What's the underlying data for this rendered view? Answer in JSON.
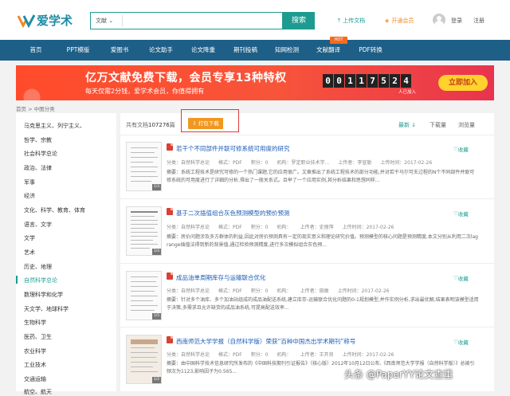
{
  "brand": {
    "name": "爱学术",
    "color": "#1f8ca6"
  },
  "search": {
    "type": "文献",
    "button": "搜索"
  },
  "header": {
    "upload": "上传文档",
    "vip": "开通会员",
    "login": "登录",
    "register": "注册"
  },
  "nav": {
    "items": [
      "首页",
      "PPT模版",
      "爱图书",
      "论文助手",
      "论文降重",
      "期刊投稿",
      "知网检测",
      "文献翻译",
      "PDF转换"
    ],
    "hot_badge": "HOT"
  },
  "banner": {
    "title": "亿万文献免费下载，会员专享13种特权",
    "subtitle": "每天仅需2分钱，爱学术会员，你值得拥有",
    "digits": [
      "0",
      "0",
      "1",
      "1",
      "7",
      "5",
      "2",
      "4"
    ],
    "counter_label": "人已加入",
    "join": "立即加入"
  },
  "breadcrumb": "首页 > 中图分类",
  "sidebar": {
    "items": [
      "马克思主义、列宁主义、",
      "哲学、宗教",
      "社会科学总论",
      "政治、法律",
      "军事",
      "经济",
      "文化、科学、教育、体育",
      "语言、文字",
      "文学",
      "艺术",
      "历史、地理",
      "自然科学总论",
      "数理科学和化学",
      "天文学、地球科学",
      "生物科学",
      "医药、卫生",
      "农业科学",
      "工业技术",
      "交通运输",
      "航空、航天"
    ],
    "active_index": 11
  },
  "list": {
    "total_prefix": "共有文档",
    "total_count": "107276",
    "total_suffix": "篇",
    "bulk_download": "打包下载",
    "sort": [
      "最新",
      "下载量",
      "浏览量"
    ]
  },
  "docs": [
    {
      "title": "若干个不同部件并联可修系统可用度的研究",
      "category": "分类：自然科学总论",
      "format": "格式：PDF",
      "score": "积分：0",
      "org": "机构：罗定职业技术学...",
      "author": "上传者：李宣聪",
      "date": "上传时间：2017-02-26",
      "abstract": "摘要：系统工程技术是研究可修的一个热门课题,它的应用很广。文章推出了系统工程技术的部分功能,并对若干马尔可夫过程的N个不同部件并联可修系统的可用度进行了详细的分析,得出了一般关系式。且举了一个应用实例,其分析结果和思想同样...",
      "fav": "收藏"
    },
    {
      "title": "基于二次插值组合灰色预测模型的预价预测",
      "category": "分类：自然科学总论",
      "format": "格式：PDF",
      "score": "积分：0",
      "org": "机构：",
      "author": "上传者：史丽萍",
      "date": "上传时间：2017-02-26",
      "abstract": "摘要：房价问题涉及多方群体的利益,因此对房价预测具有一定的现实意义和理论研究价值。预测模型的核心问题是预测精度,本文分别从利用二次lagrange插值法得到新的背景值,通过检验预测精度,进行多次模拟组合灰色预...",
      "fav": "收藏"
    },
    {
      "title": "成品油单周期库存与运输联合优化",
      "category": "分类：自然科学总论",
      "format": "格式：PDF",
      "score": "积分：0",
      "org": "机构：",
      "author": "上传者：田敢",
      "date": "上传时间：2017-02-26",
      "abstract": "摘要：针对多个油库、多个加油站组成的成品油配送系统,建立库存-运输联合优化问题的0-1规划模型,并作实例分析,求出最优解,结果表明该模型适用于决策,多需求且允许缺货的成品油系统,可提高配送效率...",
      "fav": "收藏"
    },
    {
      "title": "西南师范大学学报（自然科学版）荣获“百种中国杰出学术期刊”称号",
      "category": "分类：自然科学总论",
      "format": "格式：PDF",
      "score": "积分：0",
      "org": "机构：",
      "author": "上传者：王开良",
      "date": "上传时间：2017-02-26",
      "abstract": "摘要：由中国科学技术信息研究所发布的《中国科技期刊引证报告》（核心版）2012年10月12日公布,《西南师范大学学报（自然科学版）》总被引频次为1123,影响因子为0.565...",
      "fav": "收藏"
    }
  ],
  "watermark": "头条 @PaperYY论文查重",
  "colors": {
    "nav": "#1e5f87",
    "accent": "#1e9b91",
    "orange": "#f19720",
    "link": "#1a5bb5"
  }
}
